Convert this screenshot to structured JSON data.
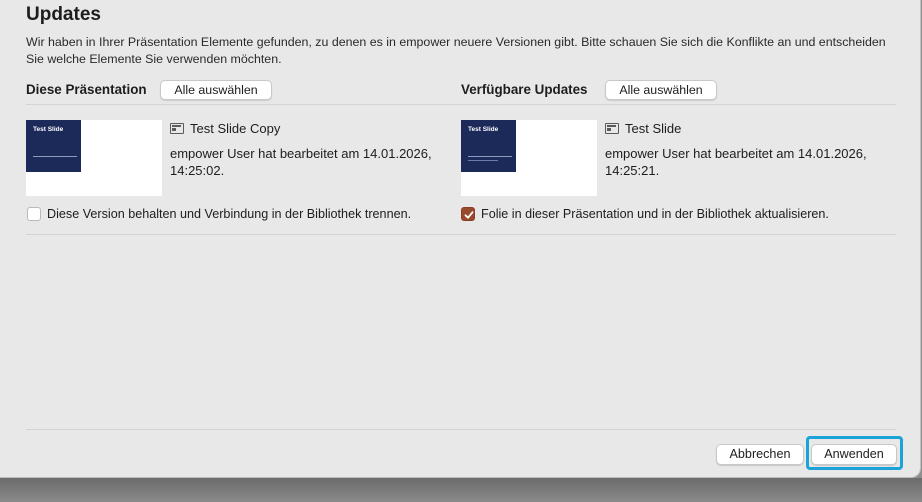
{
  "dialog": {
    "title": "Updates",
    "description": "Wir haben in Ihrer Präsentation Elemente gefunden, zu denen es in empower neuere Versionen gibt. Bitte schauen Sie sich die Konflikte an und entscheiden Sie welche Elemente Sie verwenden möchten."
  },
  "left": {
    "heading": "Diese Präsentation",
    "select_all_label": "Alle auswählen",
    "item": {
      "thumb_title": "Test Slide",
      "name": "Test Slide Copy",
      "meta": "empower User hat bearbeitet am 14.01.2026, 14:25:02."
    },
    "checkbox": {
      "label": "Diese Version behalten und Verbindung in der Bibliothek trennen.",
      "checked": false
    }
  },
  "right": {
    "heading": "Verfügbare Updates",
    "select_all_label": "Alle auswählen",
    "item": {
      "thumb_title": "Test Slide",
      "name": "Test Slide",
      "meta": "empower User hat bearbeitet am 14.01.2026, 14:25:21."
    },
    "checkbox": {
      "label": "Folie in dieser Präsentation und in der Bibliothek aktualisieren.",
      "checked": true
    }
  },
  "footer": {
    "cancel_label": "Abbrechen",
    "apply_label": "Anwenden"
  },
  "colors": {
    "accent_checkbox": "#9a4a2c",
    "focus_ring": "#1aa3d9",
    "slide_thumbnail": "#1c2a5a"
  }
}
